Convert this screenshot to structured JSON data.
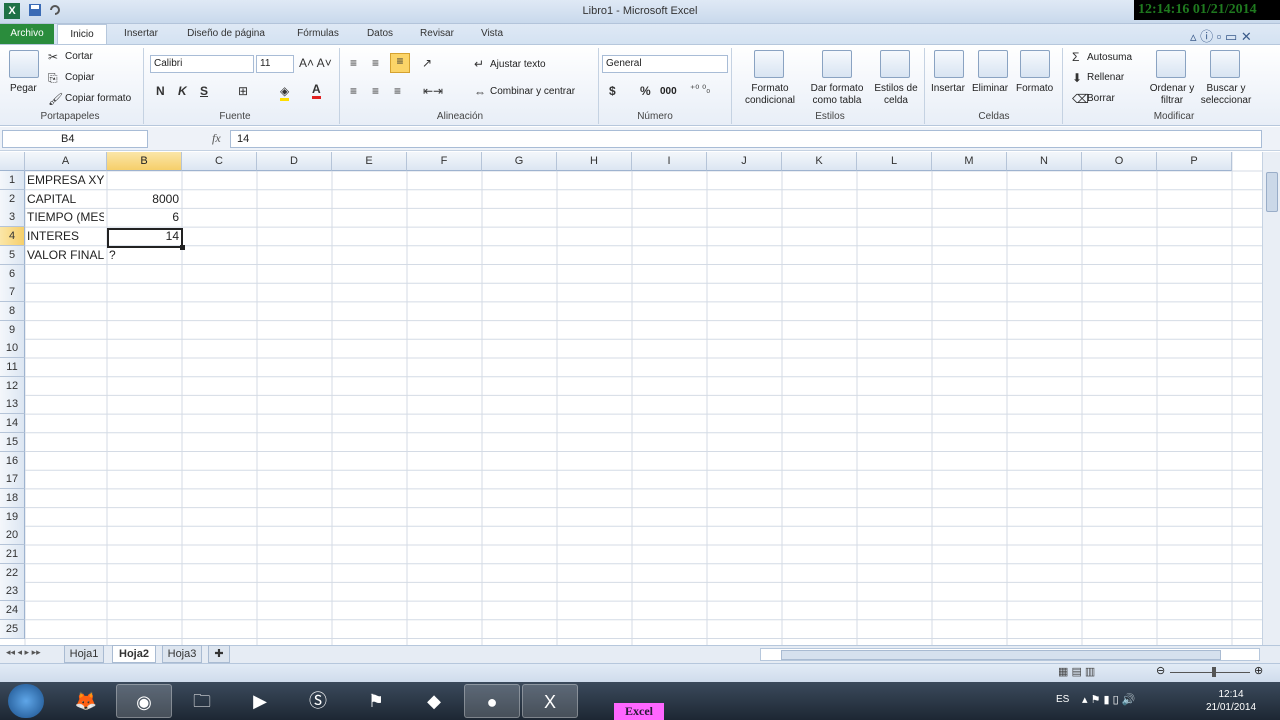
{
  "window": {
    "title": "Libro1 - Microsoft Excel",
    "clock": "12:14:16  01/21/2014"
  },
  "tabs": [
    "Archivo",
    "Inicio",
    "Insertar",
    "Diseño de página",
    "Fórmulas",
    "Datos",
    "Revisar",
    "Vista"
  ],
  "ribbon": {
    "clipboard": {
      "paste": "Pegar",
      "cut": "Cortar",
      "copy": "Copiar",
      "format_painter": "Copiar formato",
      "label": "Portapapeles"
    },
    "font": {
      "name": "Calibri",
      "size": "11",
      "bold": "N",
      "italic": "K",
      "underline": "S",
      "label": "Fuente"
    },
    "alignment": {
      "wrap": "Ajustar texto",
      "merge": "Combinar y centrar",
      "label": "Alineación"
    },
    "number": {
      "format": "General",
      "currency": "$",
      "percent": "%",
      "thousands": "000",
      "label": "Número"
    },
    "styles": {
      "conditional": "Formato condicional",
      "table": "Dar formato como tabla",
      "cell": "Estilos de celda",
      "label": "Estilos"
    },
    "cells": {
      "insert": "Insertar",
      "delete": "Eliminar",
      "format": "Formato",
      "label": "Celdas"
    },
    "editing": {
      "autosum": "Autosuma",
      "fill": "Rellenar",
      "clear": "Borrar",
      "sort": "Ordenar y filtrar",
      "find": "Buscar y seleccionar",
      "label": "Modificar"
    }
  },
  "formula_bar": {
    "name_box": "B4",
    "fx": "fx",
    "value": "14"
  },
  "columns": [
    "A",
    "B",
    "C",
    "D",
    "E",
    "F",
    "G",
    "H",
    "I",
    "J",
    "K",
    "L",
    "M",
    "N",
    "O",
    "P"
  ],
  "selected_column": "B",
  "selected_row": "4",
  "rows": [
    "1",
    "2",
    "3",
    "4",
    "5",
    "6",
    "7",
    "8",
    "9",
    "10",
    "11",
    "12",
    "13",
    "14",
    "15",
    "16",
    "17",
    "18",
    "19",
    "20",
    "21",
    "22",
    "23",
    "24",
    "25"
  ],
  "cells": {
    "A1": "EMPRESA XY",
    "A2": "CAPITAL",
    "A3": "TIEMPO (MESES)",
    "A4": "INTERES",
    "A5": "VALOR FINAL",
    "B2": "8000",
    "B3": "6",
    "B4": "14",
    "B5": "?"
  },
  "sheets": [
    "Hoja1",
    "Hoja2",
    "Hoja3"
  ],
  "active_sheet": "Hoja2",
  "taskbar": {
    "label": "Excel",
    "lang": "ES",
    "time": "12:14",
    "date": "21/01/2014"
  }
}
